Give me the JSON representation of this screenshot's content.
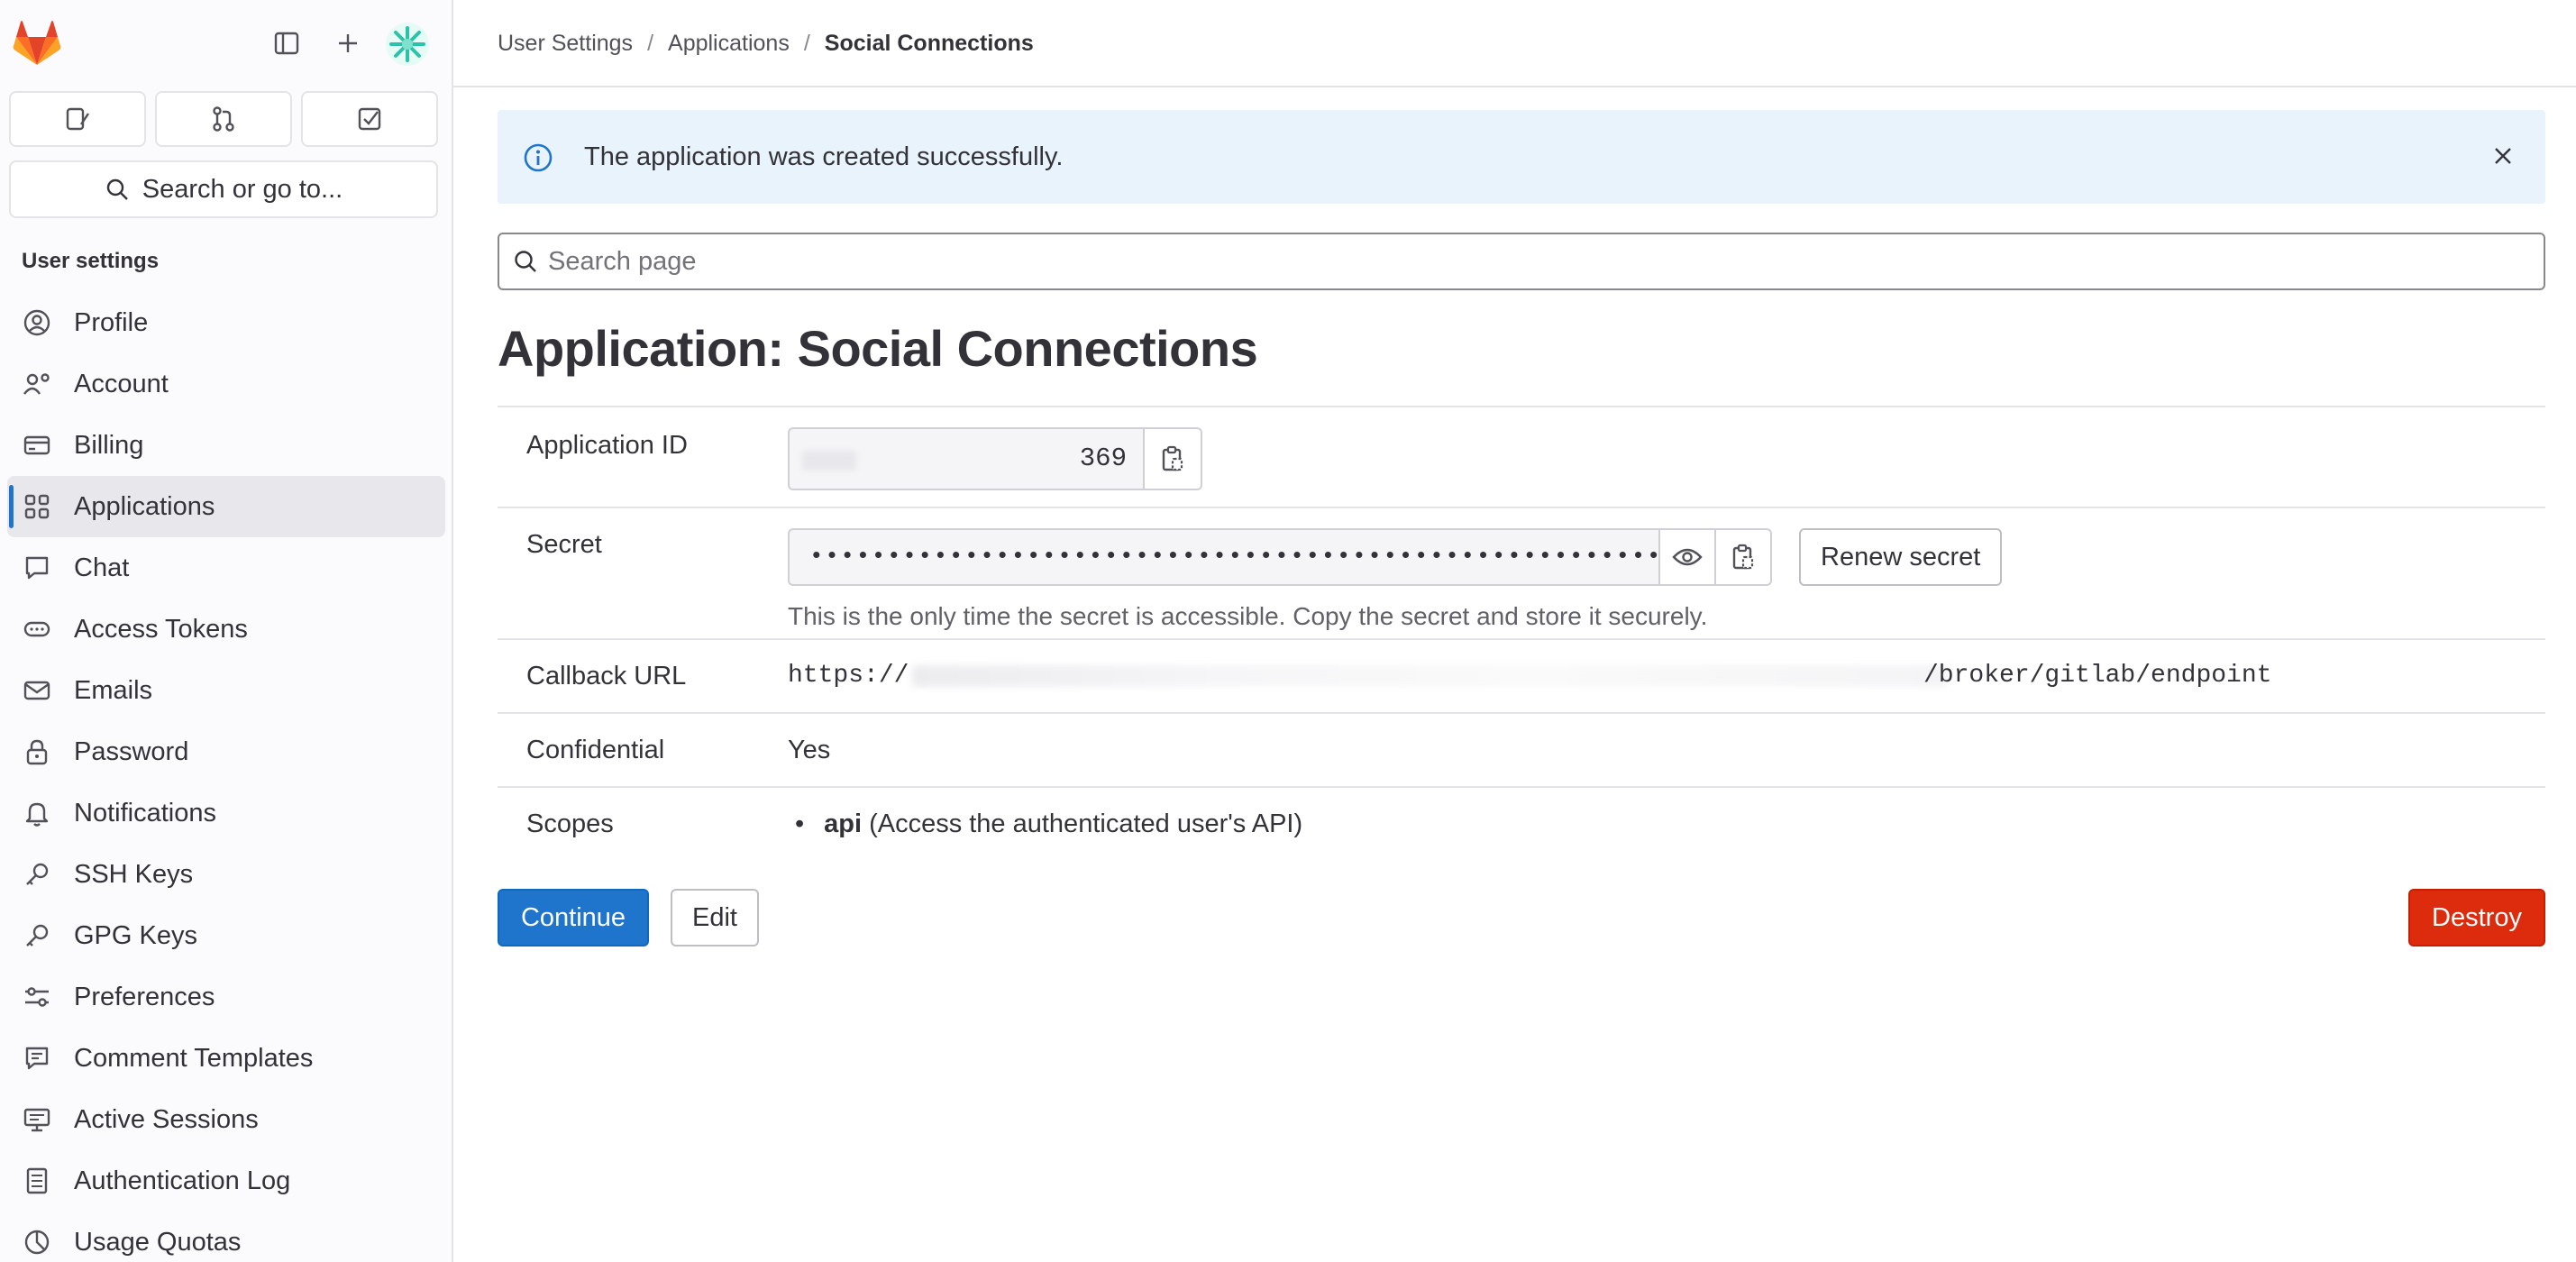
{
  "sidebar": {
    "section_title": "User settings",
    "search_label": "Search or go to...",
    "items": [
      {
        "label": "Profile",
        "icon": "profile-icon"
      },
      {
        "label": "Account",
        "icon": "account-icon"
      },
      {
        "label": "Billing",
        "icon": "billing-icon"
      },
      {
        "label": "Applications",
        "icon": "applications-icon",
        "active": true
      },
      {
        "label": "Chat",
        "icon": "chat-icon"
      },
      {
        "label": "Access Tokens",
        "icon": "token-icon"
      },
      {
        "label": "Emails",
        "icon": "mail-icon"
      },
      {
        "label": "Password",
        "icon": "lock-icon"
      },
      {
        "label": "Notifications",
        "icon": "bell-icon"
      },
      {
        "label": "SSH Keys",
        "icon": "key-icon"
      },
      {
        "label": "GPG Keys",
        "icon": "key-icon"
      },
      {
        "label": "Preferences",
        "icon": "preferences-icon"
      },
      {
        "label": "Comment Templates",
        "icon": "comment-icon"
      },
      {
        "label": "Active Sessions",
        "icon": "monitor-icon"
      },
      {
        "label": "Authentication Log",
        "icon": "log-icon"
      },
      {
        "label": "Usage Quotas",
        "icon": "quota-icon"
      }
    ]
  },
  "breadcrumb": {
    "items": [
      "User Settings",
      "Applications"
    ],
    "current": "Social Connections"
  },
  "alert": {
    "message": "The application was created successfully."
  },
  "page_search": {
    "placeholder": "Search page"
  },
  "page": {
    "title": "Application: Social Connections"
  },
  "details": {
    "app_id_label": "Application ID",
    "app_id_value": "369",
    "secret_label": "Secret",
    "secret_masked": "•••••••••••••••••••••••••••••••••••••••••••••••••••••••",
    "renew_label": "Renew secret",
    "secret_help": "This is the only time the secret is accessible. Copy the secret and store it securely.",
    "callback_label": "Callback URL",
    "callback_prefix": "https://",
    "callback_suffix": "/broker/gitlab/endpoint",
    "confidential_label": "Confidential",
    "confidential_value": "Yes",
    "scopes_label": "Scopes",
    "scope_name": "api",
    "scope_desc": "(Access the authenticated user's API)"
  },
  "actions": {
    "continue": "Continue",
    "edit": "Edit",
    "destroy": "Destroy"
  },
  "colors": {
    "accent": "#1f75cb",
    "danger": "#dd2b0e",
    "alert_bg": "#e9f3fc",
    "logo_orange": "#fc6d26"
  }
}
